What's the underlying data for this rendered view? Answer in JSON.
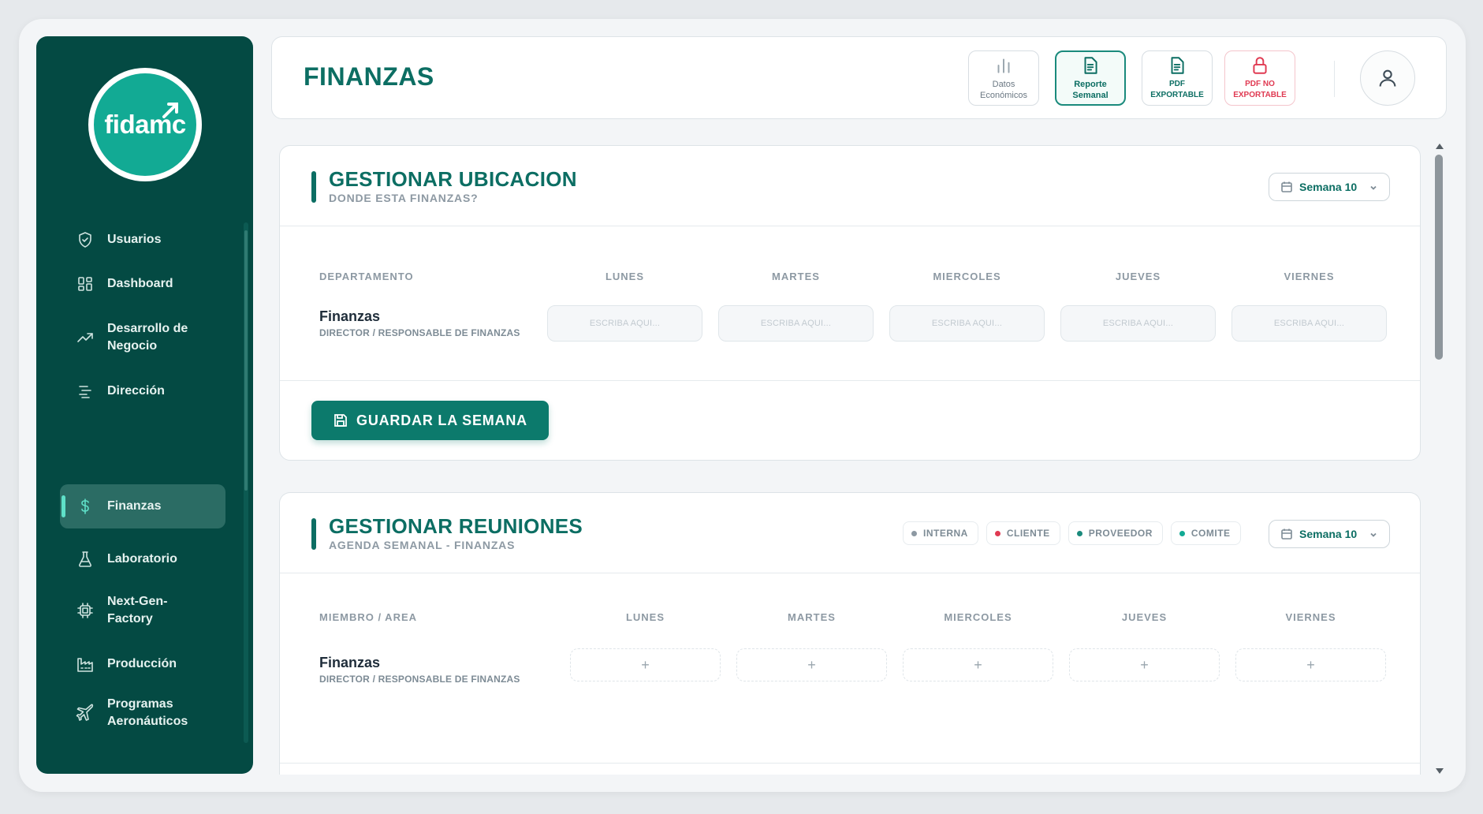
{
  "brand": {
    "logo_text": "fidamc"
  },
  "sidebar": {
    "items": [
      {
        "label": "Usuarios",
        "icon": "shield-icon"
      },
      {
        "label": "Dashboard",
        "icon": "grid-icon"
      },
      {
        "label": "Desarrollo de Negocio",
        "icon": "trend-icon"
      },
      {
        "label": "Dirección",
        "icon": "list-icon"
      },
      {
        "label": "Finanzas",
        "icon": "dollar-icon",
        "active": true
      },
      {
        "label": "Laboratorio",
        "icon": "flask-icon"
      },
      {
        "label": "Next-Gen-Factory",
        "icon": "chip-icon"
      },
      {
        "label": "Producción",
        "icon": "factory-icon"
      },
      {
        "label": "Programas Aeronáuticos",
        "icon": "plane-icon"
      }
    ]
  },
  "header": {
    "title": "FINANZAS",
    "buttons": {
      "datos": "Datos Económicos",
      "reporte": "Reporte Semanal",
      "pdf": "PDF EXPORTABLE",
      "pdf_no": "PDF NO EXPORTABLE"
    }
  },
  "ubicacion": {
    "title": "GESTIONAR UBICACION",
    "subtitle": "DONDE ESTA FINANZAS?",
    "week": "Semana 10",
    "columns": [
      "DEPARTAMENTO",
      "LUNES",
      "MARTES",
      "MIERCOLES",
      "JUEVES",
      "VIERNES"
    ],
    "row": {
      "name": "Finanzas",
      "role": "DIRECTOR / RESPONSABLE DE FINANZAS"
    },
    "input_placeholder": "ESCRIBA AQUI...",
    "save_label": "GUARDAR LA SEMANA"
  },
  "reuniones": {
    "title": "GESTIONAR REUNIONES",
    "subtitle": "AGENDA SEMANAL - FINANZAS",
    "week": "Semana 10",
    "legend": [
      {
        "label": "INTERNA",
        "color": "#8d99a3"
      },
      {
        "label": "CLIENTE",
        "color": "#e03a52"
      },
      {
        "label": "PROVEEDOR",
        "color": "#1a8a7c"
      },
      {
        "label": "COMITE",
        "color": "#12aa94"
      }
    ],
    "columns": [
      "MIEMBRO / AREA",
      "LUNES",
      "MARTES",
      "MIERCOLES",
      "JUEVES",
      "VIERNES"
    ],
    "row": {
      "name": "Finanzas",
      "role": "DIRECTOR / RESPONSABLE DE FINANZAS"
    },
    "add_symbol": "+"
  },
  "colors": {
    "primary": "#0c6e63",
    "sidebar": "#044a43",
    "danger": "#e03a52"
  }
}
